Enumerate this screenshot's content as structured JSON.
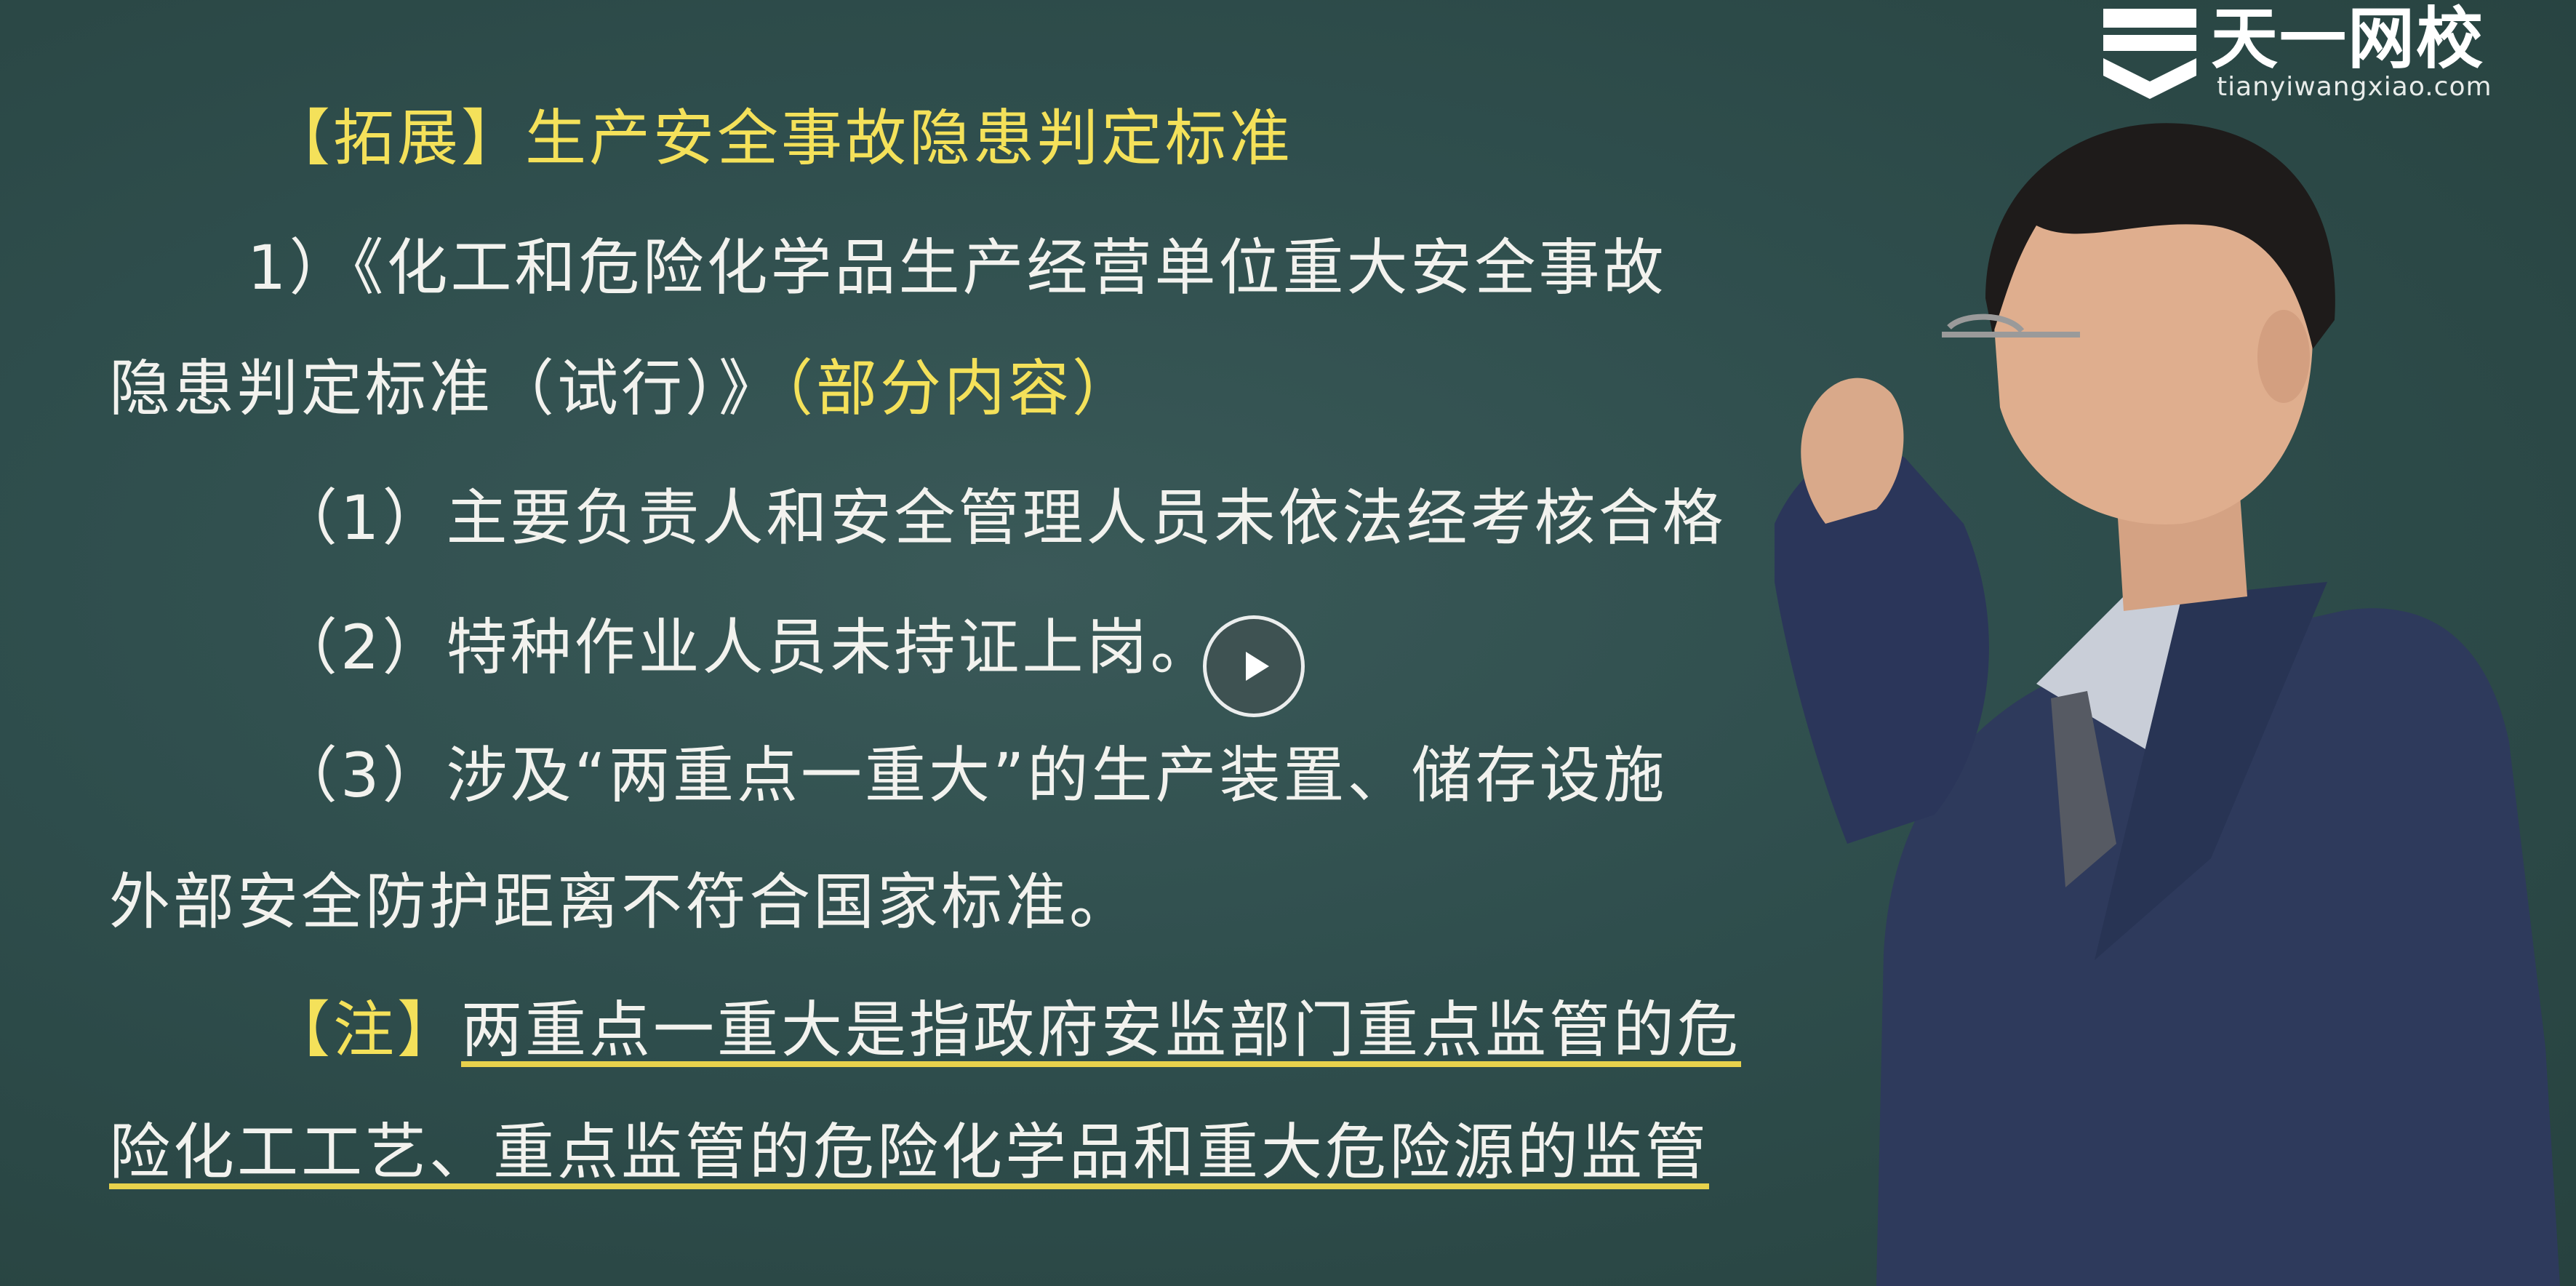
{
  "logo": {
    "brand": "天一网校",
    "url": "tianyiwangxiao.com"
  },
  "slide": {
    "heading_tag": "【拓展】",
    "heading_title": "生产安全事故隐患判定标准",
    "item1_line1": "1）《化工和危险化学品生产经营单位重大安全事故",
    "item1_line2_a": "隐患判定标准（试行）》",
    "item1_line2_b": "（部分内容）",
    "item_a": "（1）主要负责人和安全管理人员未依法经考核合格",
    "item_b": "（2）特种作业人员未持证上岗。",
    "item_c_line1": "（3）涉及“两重点一重大”的生产装置、储存设施",
    "item_c_line2": "外部安全防护距离不符合国家标准。",
    "note_tag": "【注】",
    "note_line1": "两重点一重大是指政府安监部门重点监管的危",
    "note_line2": "险化工工艺、重点监管的危险化学品和重大危险源的监管"
  },
  "player": {
    "play_icon": "play-icon"
  },
  "colors": {
    "board": "#2f4e4d",
    "text": "#f2f2ee",
    "highlight": "#f4e15a"
  }
}
